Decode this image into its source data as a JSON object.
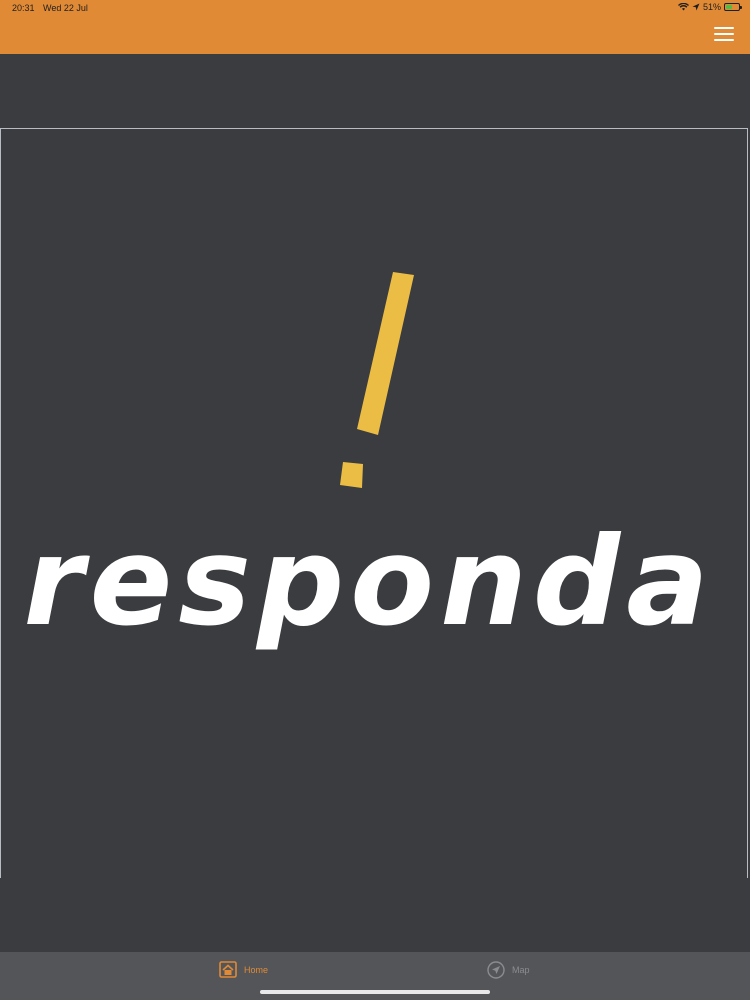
{
  "status_bar": {
    "time": "20:31",
    "date": "Wed 22 Jul",
    "battery_percent_label": "51%",
    "battery_level": 0.51,
    "icons": [
      "wifi-icon",
      "location-arrow-icon",
      "battery-icon"
    ]
  },
  "header": {
    "background_color": "#e08a36",
    "menu_icon": "hamburger-menu-icon"
  },
  "logo": {
    "text": "responda",
    "mark_icon": "exclamation-mark-icon",
    "mark_color": "#ebbd45",
    "text_color": "#ffffff"
  },
  "tabbar": {
    "tabs": [
      {
        "label": "Home",
        "icon": "home-icon",
        "selected": true
      },
      {
        "label": "Map",
        "icon": "navigation-icon",
        "selected": false
      }
    ],
    "active_color": "#e08a36",
    "inactive_color": "#8b8c90"
  }
}
